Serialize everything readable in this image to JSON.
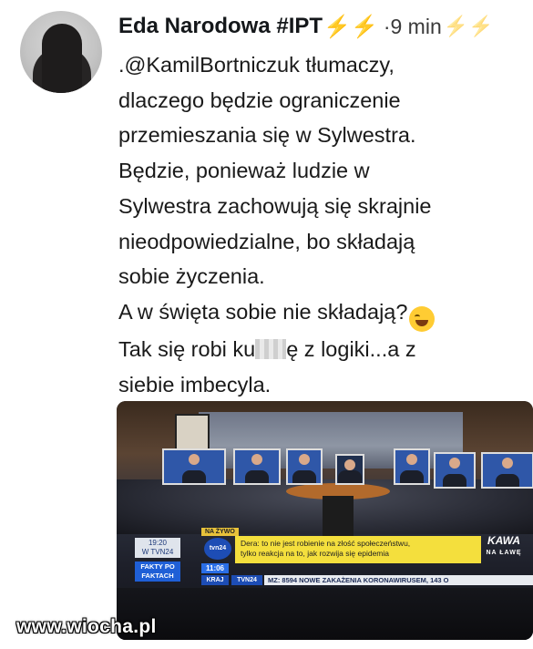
{
  "tweet": {
    "author_name": "Eda Narodowa #IPT",
    "author_emoji": "⚡⚡",
    "time": "·9 min",
    "lines": [
      ".@KamilBortniczuk tłumaczy,",
      "dlaczego będzie ograniczenie",
      "przemieszania się w Sylwestra.",
      "Będzie, ponieważ ludzie w",
      "Sylwestra zachowują się skrajnie",
      "nieodpowiedzialne, bo składają",
      "sobie życzenia.",
      "A  w święta sobie nie składają?",
      "Tak się robi ku",
      "ę z logiki...a z",
      "siebie imbecyla."
    ],
    "emoji_name": "laughing-tears-icon"
  },
  "tv": {
    "na_zywo": "NA ŻYWO",
    "channel_time": "19:20",
    "channel_name": "W TVN24",
    "fakty": "FAKTY PO FAKTACH",
    "logo": "tvn24",
    "clock": "11:06",
    "krai": "KRAJ",
    "tvn24_small": "TVN24",
    "headline_1": "Dera: to nie jest robienie na złość społeczeństwu,",
    "headline_2": "tylko reakcja na to, jak rozwija się epidemia",
    "ticker": "MZ: 8594 NOWE ZAKAŻENIA KORONAWIRUSEM, 143 O",
    "show_title": "KAWA",
    "show_subtitle": "NA ŁAWĘ"
  },
  "watermark": "www.wiocha.pl",
  "colors": {
    "bolt": "#f4a524",
    "ticker_yellow": "#f4df3d",
    "tvn_blue": "#1d4db5"
  }
}
